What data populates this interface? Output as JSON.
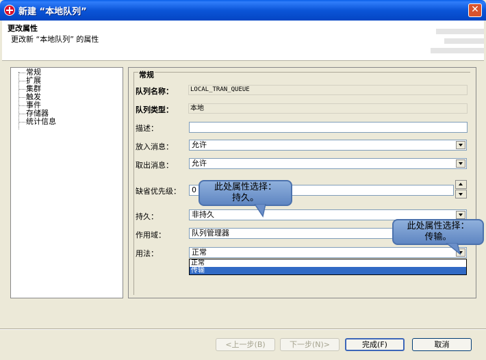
{
  "window": {
    "title": "新建 “本地队列”"
  },
  "header": {
    "title": "更改属性",
    "description": "更改新 “本地队列” 的属性"
  },
  "tree": {
    "items": [
      "常规",
      "扩展",
      "集群",
      "触发",
      "事件",
      "存储器",
      "统计信息"
    ]
  },
  "group": {
    "title": "常规"
  },
  "fields": {
    "queue_name_label": "队列名称：",
    "queue_name_value": "LOCAL_TRAN_QUEUE",
    "queue_type_label": "队列类型：",
    "queue_type_value": "本地",
    "description_label": "描述：",
    "description_value": "",
    "put_label": "放入消息：",
    "put_value": "允许",
    "get_label": "取出消息：",
    "get_value": "允许",
    "priority_label": "缺省优先级：",
    "priority_value": "0",
    "persistence_label": "持久：",
    "persistence_value": "非持久",
    "scope_label": "作用域：",
    "scope_value": "队列管理器",
    "usage_label": "用法：",
    "usage_value": "正常",
    "usage_options": [
      "正常",
      "传输"
    ],
    "usage_selected": "传输"
  },
  "callouts": {
    "persistence_line1": "此处属性选择：",
    "persistence_line2": "持久。",
    "usage_line1": "此处属性选择：",
    "usage_line2": "传输。"
  },
  "buttons": {
    "back": "<上一步(B)",
    "next": "下一步(N)>",
    "finish": "完成(F)",
    "cancel": "取消"
  },
  "colors": {
    "titlebar": "#0b55d8",
    "selection": "#316ac5",
    "callout": "#7a9ed3"
  }
}
